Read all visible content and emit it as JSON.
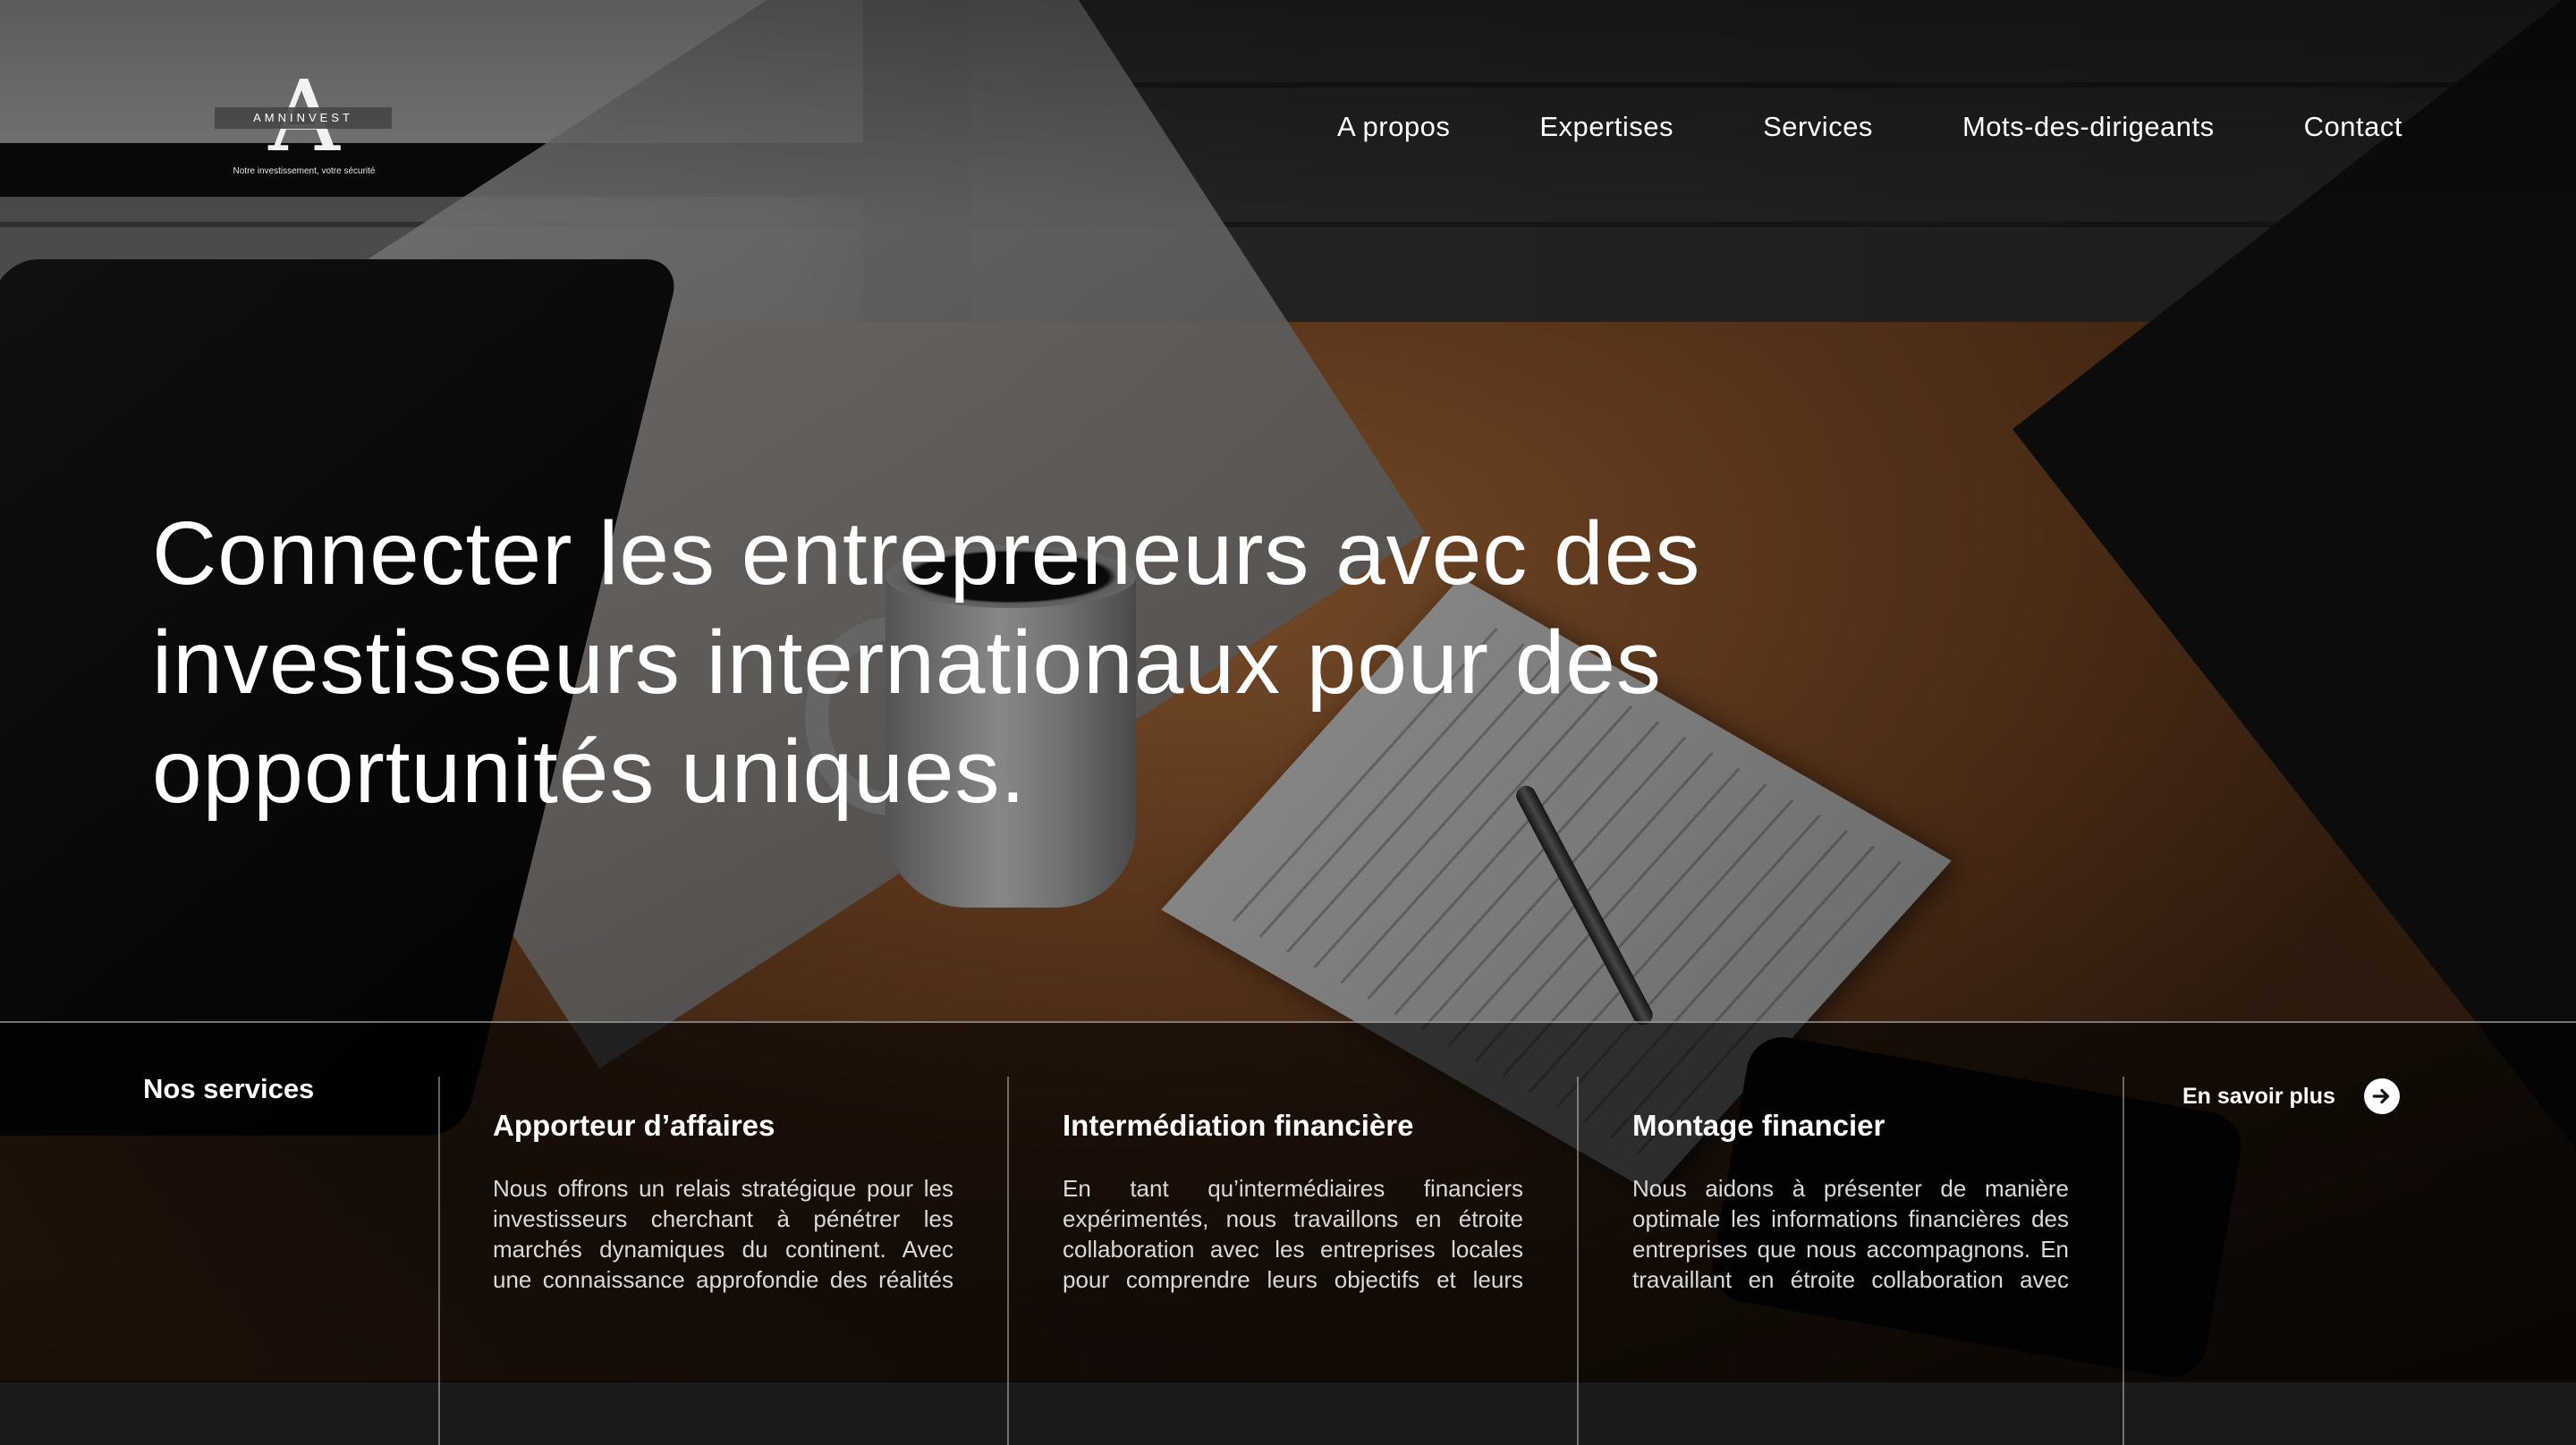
{
  "brand": {
    "logo_letter": "A",
    "name": "AMNINVEST",
    "tagline": "Notre investissement, votre sécurité"
  },
  "nav": {
    "items": [
      {
        "label": "A propos"
      },
      {
        "label": "Expertises"
      },
      {
        "label": "Services"
      },
      {
        "label": "Mots-des-dirigeants"
      },
      {
        "label": "Contact"
      }
    ]
  },
  "hero": {
    "title": "Connecter les entrepreneurs avec des investisseurs internationaux pour des opportunités uniques."
  },
  "services": {
    "heading": "Nos services",
    "cards": [
      {
        "title": "Apporteur d’affaires",
        "text": "Nous offrons un relais stratégique pour les investisseurs cherchant à pénétrer les marchés dynamiques du continent. Avec une connaissance approfondie des réalités locales et un vaste réseau"
      },
      {
        "title": "Intermédiation financière",
        "text": "En tant qu’intermédiaires financiers expérimentés, nous travaillons en étroite collaboration avec les entreprises locales pour comprendre leurs objectifs et leurs défis financiers.Ensuite nous"
      },
      {
        "title": "Montage financier",
        "text": "Nous aidons à présenter de manière optimale les informations financières des entreprises que nous accompagnons. En travaillant en étroite collaboration avec nos clients,"
      }
    ],
    "more_label": "En savoir plus",
    "more_icon": "arrow-right-circle-icon"
  },
  "colors": {
    "text": "#ffffff",
    "muted_text": "#d9d9d9",
    "overlay": "#000000"
  }
}
